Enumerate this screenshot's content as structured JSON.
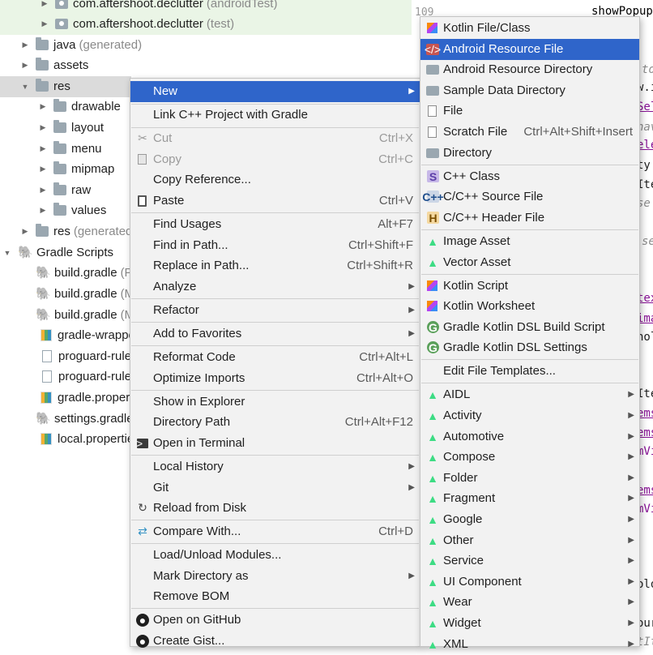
{
  "tree": {
    "line_number": "109",
    "code_top": "showPopup",
    "items": [
      {
        "label": "com.aftershoot.declutter",
        "suffix": "(androidTest)"
      },
      {
        "label": "com.aftershoot.declutter",
        "suffix": "(test)"
      },
      {
        "label": "java",
        "suffix": "(generated)"
      },
      {
        "label": "assets",
        "suffix": ""
      },
      {
        "label": "res",
        "suffix": ""
      },
      {
        "label": "drawable",
        "suffix": ""
      },
      {
        "label": "layout",
        "suffix": ""
      },
      {
        "label": "menu",
        "suffix": ""
      },
      {
        "label": "mipmap",
        "suffix": ""
      },
      {
        "label": "raw",
        "suffix": ""
      },
      {
        "label": "values",
        "suffix": ""
      },
      {
        "label": "res",
        "suffix": "(generated"
      },
      {
        "label": "Gradle Scripts",
        "suffix": ""
      },
      {
        "label": "build.gradle",
        "suffix": "(P"
      },
      {
        "label": "build.gradle",
        "suffix": "(M"
      },
      {
        "label": "build.gradle",
        "suffix": "(M"
      },
      {
        "label": "gradle-wrappe",
        "suffix": ""
      },
      {
        "label": "proguard-rule",
        "suffix": ""
      },
      {
        "label": "proguard-rule",
        "suffix": ""
      },
      {
        "label": "gradle.propert",
        "suffix": ""
      },
      {
        "label": "settings.gradle",
        "suffix": ""
      },
      {
        "label": "local.propertie",
        "suffix": ""
      }
    ]
  },
  "code_fragments": [
    "to",
    "w.i",
    "Sel",
    "nav",
    "ele",
    "ty",
    "Ite",
    "se",
    "se",
    "tex",
    "ima",
    "hol",
    "Ite",
    "ems",
    "ems",
    "mVi",
    "ems",
    "mVi",
    "olo",
    "our",
    "tIte"
  ],
  "context_menu": {
    "items": [
      {
        "label": "New",
        "shortcut": "",
        "submenu": true
      },
      {
        "label": "Link C++ Project with Gradle",
        "shortcut": ""
      },
      {
        "label": "Cut",
        "shortcut": "Ctrl+X"
      },
      {
        "label": "Copy",
        "shortcut": "Ctrl+C"
      },
      {
        "label": "Copy Reference...",
        "shortcut": ""
      },
      {
        "label": "Paste",
        "shortcut": "Ctrl+V"
      },
      {
        "label": "Find Usages",
        "shortcut": "Alt+F7"
      },
      {
        "label": "Find in Path...",
        "shortcut": "Ctrl+Shift+F"
      },
      {
        "label": "Replace in Path...",
        "shortcut": "Ctrl+Shift+R"
      },
      {
        "label": "Analyze",
        "shortcut": "",
        "submenu": true
      },
      {
        "label": "Refactor",
        "shortcut": "",
        "submenu": true
      },
      {
        "label": "Add to Favorites",
        "shortcut": "",
        "submenu": true
      },
      {
        "label": "Reformat Code",
        "shortcut": "Ctrl+Alt+L"
      },
      {
        "label": "Optimize Imports",
        "shortcut": "Ctrl+Alt+O"
      },
      {
        "label": "Show in Explorer",
        "shortcut": ""
      },
      {
        "label": "Directory Path",
        "shortcut": "Ctrl+Alt+F12"
      },
      {
        "label": "Open in Terminal",
        "shortcut": ""
      },
      {
        "label": "Local History",
        "shortcut": "",
        "submenu": true
      },
      {
        "label": "Git",
        "shortcut": "",
        "submenu": true
      },
      {
        "label": "Reload from Disk",
        "shortcut": ""
      },
      {
        "label": "Compare With...",
        "shortcut": "Ctrl+D"
      },
      {
        "label": "Load/Unload Modules...",
        "shortcut": ""
      },
      {
        "label": "Mark Directory as",
        "shortcut": "",
        "submenu": true
      },
      {
        "label": "Remove BOM",
        "shortcut": ""
      },
      {
        "label": "Open on GitHub",
        "shortcut": ""
      },
      {
        "label": "Create Gist...",
        "shortcut": ""
      }
    ]
  },
  "new_submenu": {
    "items": [
      {
        "label": "Kotlin File/Class",
        "shortcut": ""
      },
      {
        "label": "Android Resource File",
        "shortcut": ""
      },
      {
        "label": "Android Resource Directory",
        "shortcut": ""
      },
      {
        "label": "Sample Data Directory",
        "shortcut": ""
      },
      {
        "label": "File",
        "shortcut": ""
      },
      {
        "label": "Scratch File",
        "shortcut": "Ctrl+Alt+Shift+Insert"
      },
      {
        "label": "Directory",
        "shortcut": ""
      },
      {
        "label": "C++ Class",
        "shortcut": ""
      },
      {
        "label": "C/C++ Source File",
        "shortcut": ""
      },
      {
        "label": "C/C++ Header File",
        "shortcut": ""
      },
      {
        "label": "Image Asset",
        "shortcut": ""
      },
      {
        "label": "Vector Asset",
        "shortcut": ""
      },
      {
        "label": "Kotlin Script",
        "shortcut": ""
      },
      {
        "label": "Kotlin Worksheet",
        "shortcut": ""
      },
      {
        "label": "Gradle Kotlin DSL Build Script",
        "shortcut": ""
      },
      {
        "label": "Gradle Kotlin DSL Settings",
        "shortcut": ""
      },
      {
        "label": "Edit File Templates...",
        "shortcut": ""
      },
      {
        "label": "AIDL",
        "shortcut": "",
        "submenu": true
      },
      {
        "label": "Activity",
        "shortcut": "",
        "submenu": true
      },
      {
        "label": "Automotive",
        "shortcut": "",
        "submenu": true
      },
      {
        "label": "Compose",
        "shortcut": "",
        "submenu": true
      },
      {
        "label": "Folder",
        "shortcut": "",
        "submenu": true
      },
      {
        "label": "Fragment",
        "shortcut": "",
        "submenu": true
      },
      {
        "label": "Google",
        "shortcut": "",
        "submenu": true
      },
      {
        "label": "Other",
        "shortcut": "",
        "submenu": true
      },
      {
        "label": "Service",
        "shortcut": "",
        "submenu": true
      },
      {
        "label": "UI Component",
        "shortcut": "",
        "submenu": true
      },
      {
        "label": "Wear",
        "shortcut": "",
        "submenu": true
      },
      {
        "label": "Widget",
        "shortcut": "",
        "submenu": true
      },
      {
        "label": "XML",
        "shortcut": "",
        "submenu": true
      }
    ]
  },
  "colors": {
    "highlight": "#2f65ca",
    "menu_bg": "#f2f2f2",
    "android_green": "#3ddc84"
  }
}
